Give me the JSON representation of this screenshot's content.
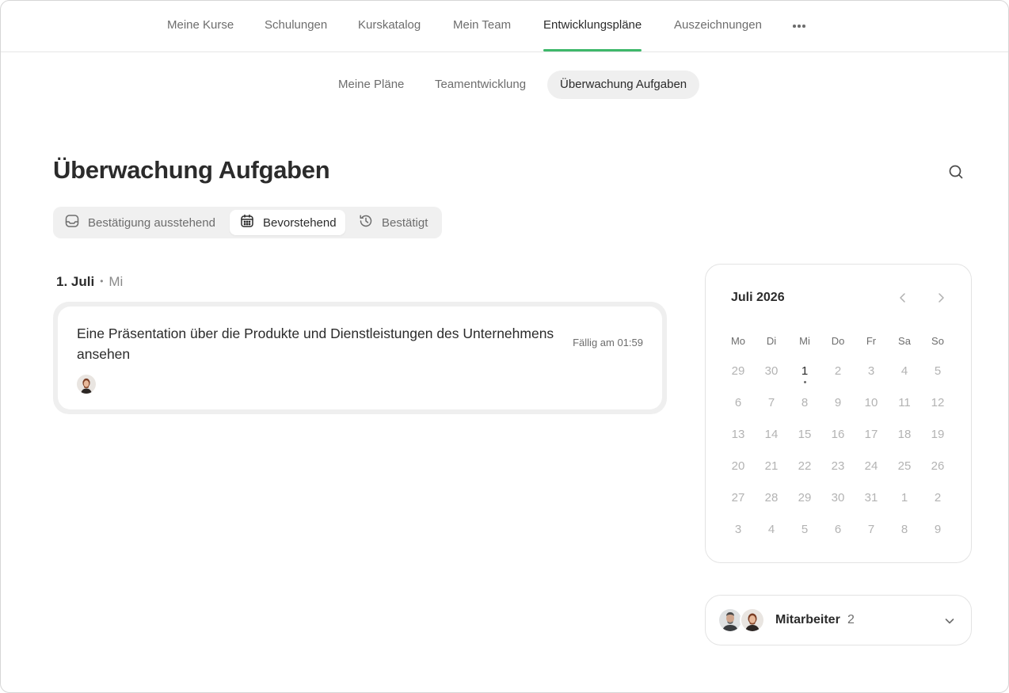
{
  "topnav": {
    "items": [
      {
        "label": "Meine Kurse"
      },
      {
        "label": "Schulungen"
      },
      {
        "label": "Kurskatalog"
      },
      {
        "label": "Mein Team"
      },
      {
        "label": "Entwicklungspläne",
        "active": true
      },
      {
        "label": "Auszeichnungen"
      }
    ],
    "more_icon": "more-dots-icon",
    "accent_color": "#3db86a"
  },
  "subnav": {
    "items": [
      {
        "label": "Meine Pläne"
      },
      {
        "label": "Teamentwicklung"
      },
      {
        "label": "Überwachung Aufgaben",
        "active": true
      }
    ]
  },
  "page": {
    "title": "Überwachung Aufgaben",
    "search_icon": "search-icon"
  },
  "filters": {
    "items": [
      {
        "label": "Bestätigung ausstehend",
        "icon": "inbox-icon"
      },
      {
        "label": "Bevorstehend",
        "icon": "calendar-icon",
        "active": true
      },
      {
        "label": "Bestätigt",
        "icon": "history-icon"
      }
    ]
  },
  "date_group": {
    "day": "1. Juli",
    "separator": "•",
    "weekday": "Mi"
  },
  "task": {
    "title": "Eine Präsentation über die Produkte und Dienstleistungen des Unternehmens ansehen",
    "due": "Fällig am 01:59"
  },
  "calendar": {
    "title": "Juli 2026",
    "weekdays": [
      "Mo",
      "Di",
      "Mi",
      "Do",
      "Fr",
      "Sa",
      "So"
    ],
    "weeks": [
      [
        "29",
        "30",
        "1",
        "2",
        "3",
        "4",
        "5"
      ],
      [
        "6",
        "7",
        "8",
        "9",
        "10",
        "11",
        "12"
      ],
      [
        "13",
        "14",
        "15",
        "16",
        "17",
        "18",
        "19"
      ],
      [
        "20",
        "21",
        "22",
        "23",
        "24",
        "25",
        "26"
      ],
      [
        "27",
        "28",
        "29",
        "30",
        "31",
        "1",
        "2"
      ],
      [
        "3",
        "4",
        "5",
        "6",
        "7",
        "8",
        "9"
      ]
    ],
    "highlighted": {
      "week": 0,
      "day": 2,
      "has_event": true
    },
    "prev_icon": "chevron-left-icon",
    "next_icon": "chevron-right-icon"
  },
  "team": {
    "label": "Mitarbeiter",
    "count": "2",
    "expand_icon": "chevron-down-icon"
  }
}
